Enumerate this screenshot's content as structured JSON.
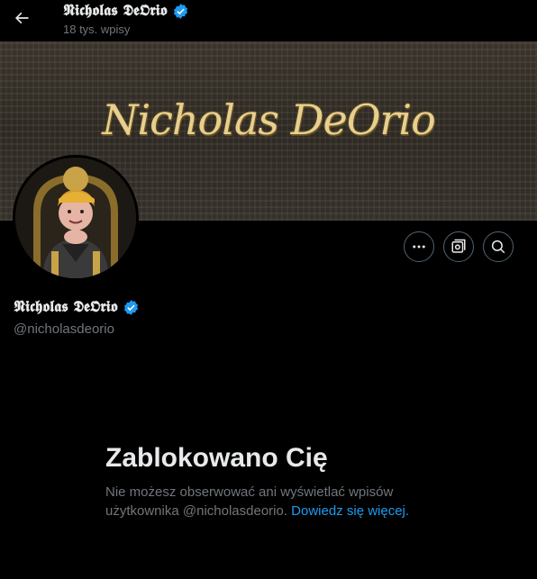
{
  "header": {
    "name": "𝕹𝖎𝖈𝖍𝖔𝖑𝖆𝖘 𝕯𝖊𝕺𝖗𝖎𝖔",
    "posts_count": "18 tys. wpisy"
  },
  "banner": {
    "logo_text": "Nicholas DeOrio"
  },
  "profile": {
    "display_name": "𝕹𝖎𝖈𝖍𝖔𝖑𝖆𝖘 𝕯𝖊𝕺𝖗𝖎𝖔",
    "handle": "@nicholasdeorio"
  },
  "blocked": {
    "title": "Zablokowano Cię",
    "message": "Nie możesz obserwować ani wyświetlać wpisów użytkownika @nicholasdeorio.",
    "learn_more": "Dowiedz się więcej."
  },
  "colors": {
    "background": "#000000",
    "accent": "#1d9bf0",
    "secondary_text": "#71767b",
    "verified": "#1d9bf0"
  },
  "icons": {
    "back": "arrow-left-icon",
    "verified": "verified-badge-icon",
    "more": "more-icon",
    "subscribe": "subscriptions-icon",
    "search": "search-icon"
  }
}
